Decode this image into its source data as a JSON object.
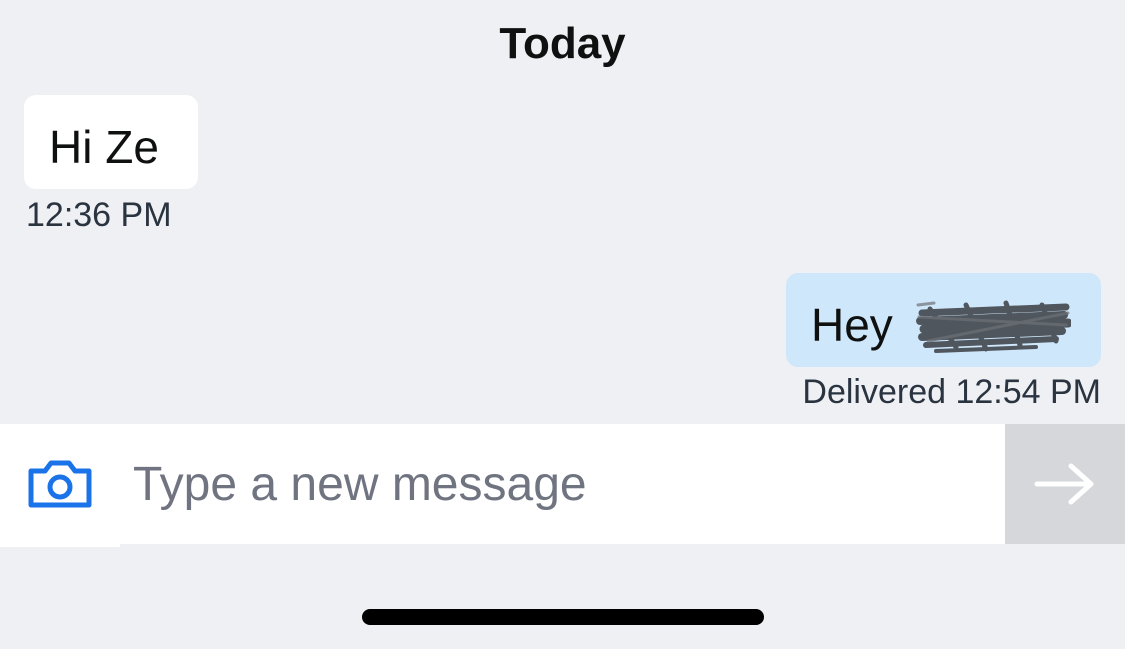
{
  "conversation": {
    "day_label": "Today",
    "messages": [
      {
        "direction": "incoming",
        "text": "Hi Ze",
        "time": "12:36 PM"
      },
      {
        "direction": "outgoing",
        "text": "Hey",
        "status": "Delivered 12:54 PM"
      }
    ]
  },
  "composer": {
    "placeholder": "Type a new message",
    "value": "",
    "camera_icon": "camera-icon",
    "send_icon": "arrow-right-icon"
  },
  "colors": {
    "background": "#eff0f3",
    "incoming_bubble": "#ffffff",
    "outgoing_bubble": "#cfe7fb",
    "accent": "#1a73e8",
    "send_button": "#d5d7db"
  }
}
